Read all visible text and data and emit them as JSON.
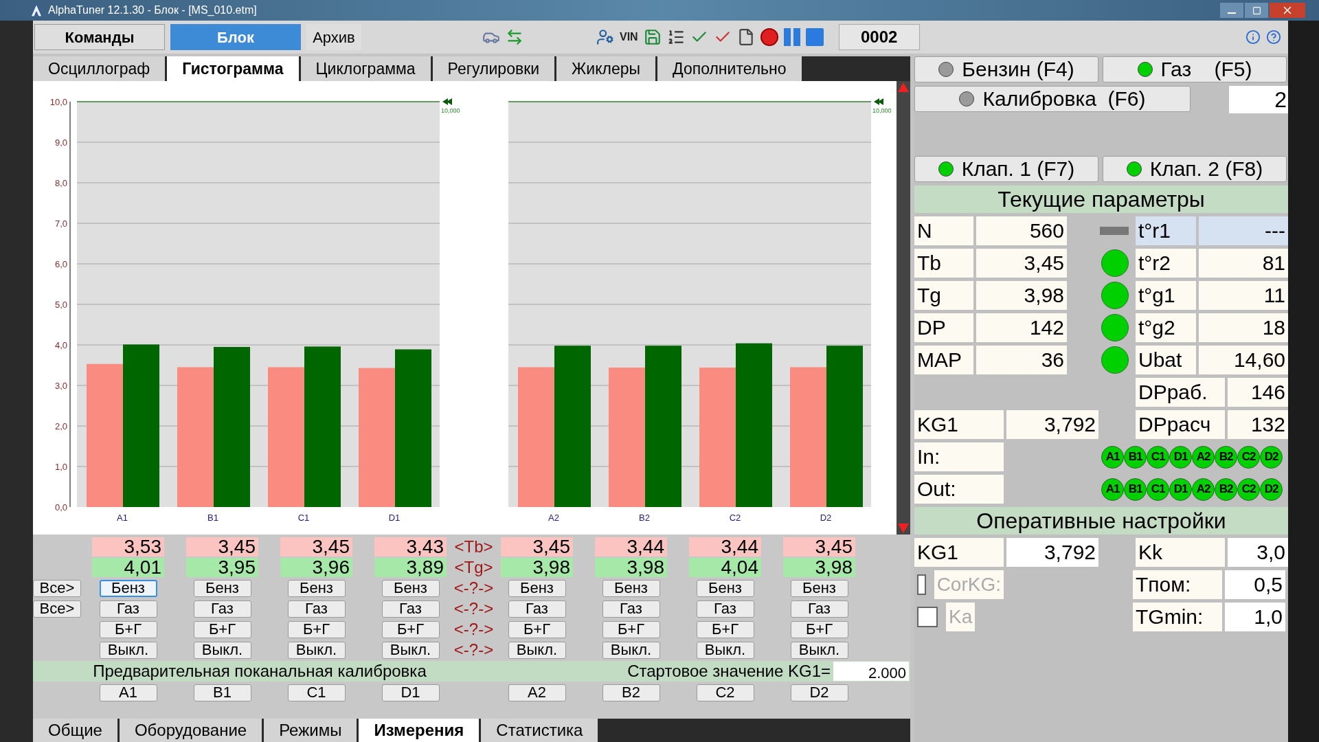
{
  "window": {
    "title": "AlphaTuner 12.1.30 - Блок - [MS_010.etm]"
  },
  "toolbar": {
    "tabs": [
      {
        "label": "Команды",
        "selected": false,
        "kind": "button"
      },
      {
        "label": "Блок",
        "selected": true,
        "kind": "button"
      },
      {
        "label": "Архив",
        "selected": false,
        "kind": "link"
      }
    ],
    "vin_label": "VIN",
    "counter": "0002"
  },
  "view_tabs": [
    {
      "label": "Осциллограф",
      "selected": false
    },
    {
      "label": "Гистограмма",
      "selected": true
    },
    {
      "label": "Циклограмма",
      "selected": false
    },
    {
      "label": "Регулировки",
      "selected": false
    },
    {
      "label": "Жиклеры",
      "selected": false
    },
    {
      "label": "Дополнительно",
      "selected": false
    }
  ],
  "charts": [
    {
      "limit_label": "10,000",
      "chart_data": {
        "type": "bar",
        "categories": [
          "A1",
          "B1",
          "C1",
          "D1"
        ],
        "ylim": [
          0,
          10
        ],
        "yticks": [
          {
            "value": 0,
            "label": "0,0"
          },
          {
            "value": 1,
            "label": "1,0"
          },
          {
            "value": 2,
            "label": "2,0"
          },
          {
            "value": 3,
            "label": "3,0"
          },
          {
            "value": 4,
            "label": "4,0"
          },
          {
            "value": 5,
            "label": "5,0"
          },
          {
            "value": 6,
            "label": "6,0"
          },
          {
            "value": 7,
            "label": "7,0"
          },
          {
            "value": 8,
            "label": "8,0"
          },
          {
            "value": 9,
            "label": "9,0"
          },
          {
            "value": 10,
            "label": "10,0"
          }
        ],
        "grid": true,
        "series": [
          {
            "color": "#fa8b80",
            "values": [
              3.53,
              3.45,
              3.45,
              3.43
            ]
          },
          {
            "color": "#006600",
            "values": [
              4.01,
              3.95,
              3.96,
              3.89
            ]
          }
        ]
      }
    },
    {
      "limit_label": "10,000",
      "chart_data": {
        "type": "bar",
        "categories": [
          "A2",
          "B2",
          "C2",
          "D2"
        ],
        "ylim": [
          0,
          10
        ],
        "grid": true,
        "series": [
          {
            "color": "#fa8b80",
            "values": [
              3.45,
              3.44,
              3.44,
              3.45
            ]
          },
          {
            "color": "#006600",
            "values": [
              3.98,
              3.98,
              4.04,
              3.98
            ]
          }
        ]
      }
    }
  ],
  "channel_table": {
    "all_buttons": [
      "Все>",
      "Все>"
    ],
    "mid_labels": [
      "<Tb>",
      "<Tg>",
      "<-?->",
      "<-?->",
      "<-?->",
      "<-?->"
    ],
    "columns": [
      {
        "tb": "3,53",
        "tg": "4,01",
        "buttons": [
          {
            "label": "Бенз",
            "focused": true
          },
          {
            "label": "Газ",
            "focused": false
          },
          {
            "label": "Б+Г",
            "focused": false
          },
          {
            "label": "Выкл.",
            "focused": false
          }
        ]
      },
      {
        "tb": "3,45",
        "tg": "3,95",
        "buttons": [
          {
            "label": "Бенз",
            "focused": false
          },
          {
            "label": "Газ",
            "focused": false
          },
          {
            "label": "Б+Г",
            "focused": false
          },
          {
            "label": "Выкл.",
            "focused": false
          }
        ]
      },
      {
        "tb": "3,45",
        "tg": "3,96",
        "buttons": [
          {
            "label": "Бенз",
            "focused": false
          },
          {
            "label": "Газ",
            "focused": false
          },
          {
            "label": "Б+Г",
            "focused": false
          },
          {
            "label": "Выкл.",
            "focused": false
          }
        ]
      },
      {
        "tb": "3,43",
        "tg": "3,89",
        "buttons": [
          {
            "label": "Бенз",
            "focused": false
          },
          {
            "label": "Газ",
            "focused": false
          },
          {
            "label": "Б+Г",
            "focused": false
          },
          {
            "label": "Выкл.",
            "focused": false
          }
        ]
      },
      {
        "tb": "3,45",
        "tg": "3,98",
        "buttons": [
          {
            "label": "Бенз",
            "focused": false
          },
          {
            "label": "Газ",
            "focused": false
          },
          {
            "label": "Б+Г",
            "focused": false
          },
          {
            "label": "Выкл.",
            "focused": false
          }
        ]
      },
      {
        "tb": "3,44",
        "tg": "3,98",
        "buttons": [
          {
            "label": "Бенз",
            "focused": false
          },
          {
            "label": "Газ",
            "focused": false
          },
          {
            "label": "Б+Г",
            "focused": false
          },
          {
            "label": "Выкл.",
            "focused": false
          }
        ]
      },
      {
        "tb": "3,44",
        "tg": "4,04",
        "buttons": [
          {
            "label": "Бенз",
            "focused": false
          },
          {
            "label": "Газ",
            "focused": false
          },
          {
            "label": "Б+Г",
            "focused": false
          },
          {
            "label": "Выкл.",
            "focused": false
          }
        ]
      },
      {
        "tb": "3,45",
        "tg": "3,98",
        "buttons": [
          {
            "label": "Бенз",
            "focused": false
          },
          {
            "label": "Газ",
            "focused": false
          },
          {
            "label": "Б+Г",
            "focused": false
          },
          {
            "label": "Выкл.",
            "focused": false
          }
        ]
      }
    ]
  },
  "calibration": {
    "title": "Предварительная поканальная калибровка",
    "start_label": "Стартовое значение KG1=",
    "start_value": "2.000",
    "channel_buttons": [
      "A1",
      "B1",
      "C1",
      "D1",
      "A2",
      "B2",
      "C2",
      "D2"
    ]
  },
  "bottom_tabs": [
    {
      "label": "Общие",
      "selected": false
    },
    {
      "label": "Оборудование",
      "selected": false
    },
    {
      "label": "Режимы",
      "selected": false
    },
    {
      "label": "Измерения",
      "selected": true
    },
    {
      "label": "Статистика",
      "selected": false
    }
  ],
  "right_panel": {
    "fuel_buttons": [
      {
        "label": "Бензин (F4)",
        "on": false
      },
      {
        "label": "Газ    (F5)",
        "on": true
      }
    ],
    "calibration_button": {
      "label": "Калибровка  (F6)",
      "on": false
    },
    "calibration_value": "2",
    "valve_buttons": [
      {
        "label": "Клап. 1 (F7)",
        "on": true
      },
      {
        "label": "Клап. 2 (F8)",
        "on": true
      }
    ],
    "current_title": "Текущие параметры",
    "params": [
      {
        "label": "N",
        "value": "560",
        "sensor": {
          "label": "t°r1",
          "value": "---",
          "active": false
        }
      },
      {
        "label": "Tb",
        "value": "3,45",
        "sensor": {
          "label": "t°r2",
          "value": "81",
          "active": true
        }
      },
      {
        "label": "Tg",
        "value": "3,98",
        "sensor": {
          "label": "t°g1",
          "value": "11",
          "active": true
        }
      },
      {
        "label": "DP",
        "value": "142",
        "sensor": {
          "label": "t°g2",
          "value": "18",
          "active": true
        }
      },
      {
        "label": "MAP",
        "value": "36",
        "sensor": {
          "label": "Ubat",
          "value": "14,60",
          "active": true
        }
      }
    ],
    "dp_work": {
      "label": "DPраб.",
      "value": "146"
    },
    "kg1": {
      "label": "KG1",
      "value": "3,792"
    },
    "dp_calc": {
      "label": "DPрасч",
      "value": "132"
    },
    "injector_rows": [
      {
        "label": "In:",
        "channels": [
          {
            "name": "A1",
            "on": true
          },
          {
            "name": "B1",
            "on": true
          },
          {
            "name": "C1",
            "on": true
          },
          {
            "name": "D1",
            "on": true
          },
          {
            "name": "A2",
            "on": true
          },
          {
            "name": "B2",
            "on": true
          },
          {
            "name": "C2",
            "on": true
          },
          {
            "name": "D2",
            "on": true
          }
        ]
      },
      {
        "label": "Out:",
        "channels": [
          {
            "name": "A1",
            "on": true
          },
          {
            "name": "B1",
            "on": true
          },
          {
            "name": "C1",
            "on": true
          },
          {
            "name": "D1",
            "on": true
          },
          {
            "name": "A2",
            "on": true
          },
          {
            "name": "B2",
            "on": true
          },
          {
            "name": "C2",
            "on": true
          },
          {
            "name": "D2",
            "on": true
          }
        ]
      }
    ],
    "settings_title": "Оперативные настройки",
    "settings_kg1": {
      "label": "KG1",
      "value": "3,792"
    },
    "settings": [
      {
        "label": "Kk",
        "value": "3,0"
      },
      {
        "label": "Tпом:",
        "value": "0,5"
      },
      {
        "label": "TGmin:",
        "value": "1,0"
      }
    ],
    "options": [
      {
        "label": "CorKG:",
        "checked": false
      },
      {
        "label": "Ka",
        "checked": false
      }
    ]
  }
}
